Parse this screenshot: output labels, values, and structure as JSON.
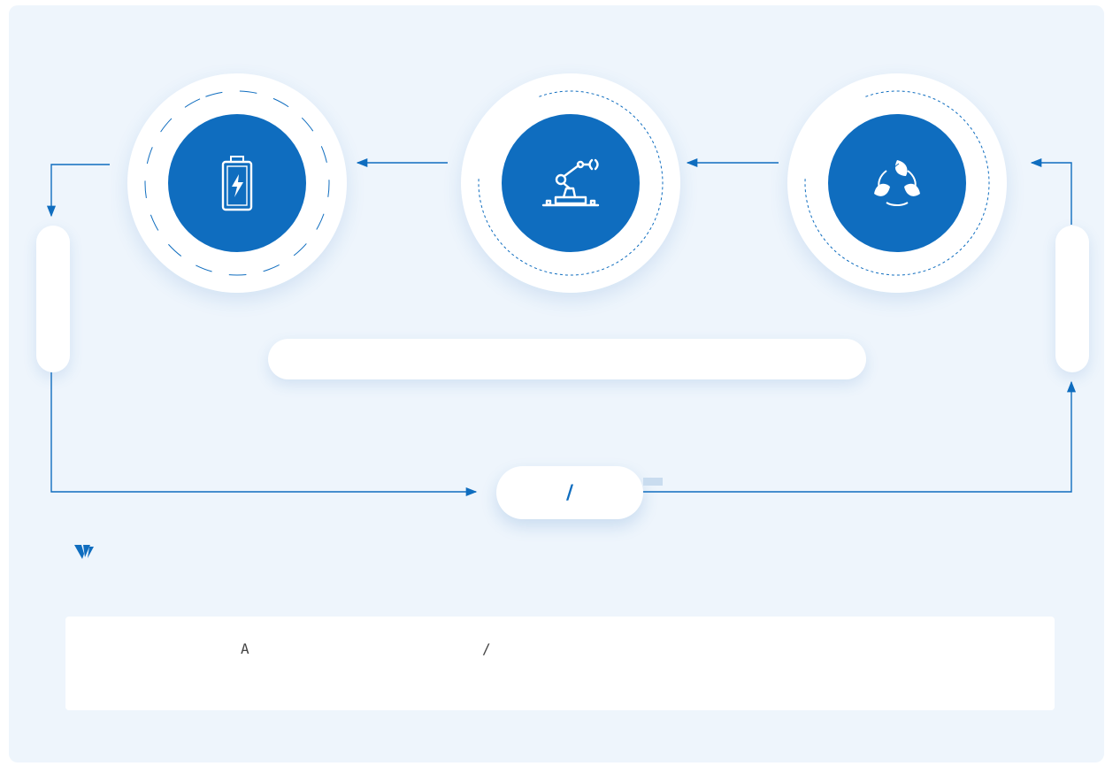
{
  "colors": {
    "primary": "#0f6dbf",
    "panel": "#eef5fc",
    "ring": "#ffffff"
  },
  "stages": [
    {
      "icon": "battery-icon"
    },
    {
      "icon": "robot-arm-icon"
    },
    {
      "icon": "recycle-leaves-icon"
    }
  ],
  "center_label": "/",
  "note": {
    "letter": "A",
    "slash": "/"
  },
  "brand_icon": "brand-logo-icon"
}
